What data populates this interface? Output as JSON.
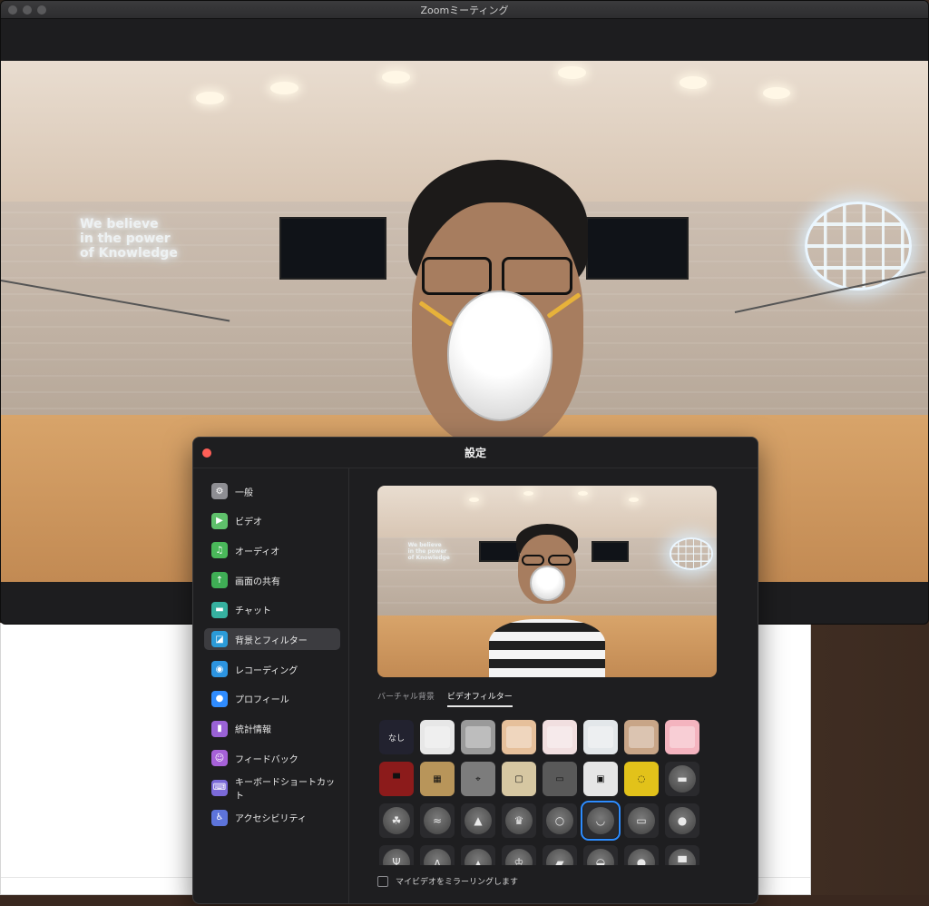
{
  "window": {
    "title": "Zoomミーティング"
  },
  "video": {
    "neon_text": [
      "We believe",
      "in the power",
      "of Knowledge"
    ]
  },
  "settings": {
    "title": "設定",
    "sidebar": [
      {
        "label": "一般",
        "icon": "gear-icon",
        "glyph": "⚙",
        "color": "#8e8e93"
      },
      {
        "label": "ビデオ",
        "icon": "video-camera-icon",
        "glyph": "▶",
        "color": "#5fc16b"
      },
      {
        "label": "オーディオ",
        "icon": "headphones-icon",
        "glyph": "♫",
        "color": "#4ab85a"
      },
      {
        "label": "画面の共有",
        "icon": "share-screen-icon",
        "glyph": "↑",
        "color": "#3fae55"
      },
      {
        "label": "チャット",
        "icon": "chat-bubble-icon",
        "glyph": "▬",
        "color": "#36b1a0"
      },
      {
        "label": "背景とフィルター",
        "icon": "background-filter-icon",
        "glyph": "◪",
        "color": "#2b9bd8",
        "active": true
      },
      {
        "label": "レコーディング",
        "icon": "record-icon",
        "glyph": "◉",
        "color": "#2c94e0"
      },
      {
        "label": "プロフィール",
        "icon": "profile-icon",
        "glyph": "●",
        "color": "#2f8cff"
      },
      {
        "label": "統計情報",
        "icon": "statistics-icon",
        "glyph": "▮",
        "color": "#9a62d6"
      },
      {
        "label": "フィードバック",
        "icon": "feedback-icon",
        "glyph": "☺",
        "color": "#a661d8"
      },
      {
        "label": "キーボードショートカット",
        "icon": "keyboard-icon",
        "glyph": "⌨",
        "color": "#7b6ad8"
      },
      {
        "label": "アクセシビリティ",
        "icon": "accessibility-icon",
        "glyph": "♿",
        "color": "#5d74da"
      }
    ],
    "tabs": [
      {
        "label": "バーチャル背景",
        "active": false
      },
      {
        "label": "ビデオフィルター",
        "active": true
      }
    ],
    "filters": [
      {
        "name": "none",
        "label": "なし",
        "kind": "text",
        "bg": "#22222f"
      },
      {
        "name": "filter-white",
        "kind": "color",
        "bg": "#e7e7e7"
      },
      {
        "name": "filter-gray",
        "kind": "color",
        "bg": "#9a9a9a"
      },
      {
        "name": "filter-peach",
        "kind": "color",
        "bg": "#e6c09b"
      },
      {
        "name": "filter-pink-light",
        "kind": "color",
        "bg": "#f1dfe0"
      },
      {
        "name": "filter-cool-white",
        "kind": "color",
        "bg": "#e3e7ea"
      },
      {
        "name": "filter-tan",
        "kind": "color",
        "bg": "#c8a587"
      },
      {
        "name": "filter-pink",
        "kind": "color",
        "bg": "#f4b4bf"
      },
      {
        "name": "frame-theater-curtain",
        "kind": "frame",
        "bg": "#8c1b1b",
        "glyph": "▀"
      },
      {
        "name": "frame-retro-tv",
        "kind": "frame",
        "bg": "#b8955a",
        "glyph": "▦"
      },
      {
        "name": "frame-focus",
        "kind": "frame",
        "bg": "#7c7c7c",
        "glyph": "⌖"
      },
      {
        "name": "frame-picture",
        "kind": "frame",
        "bg": "#d6c7a2",
        "glyph": "▢"
      },
      {
        "name": "frame-film",
        "kind": "frame",
        "bg": "#595959",
        "glyph": "▭"
      },
      {
        "name": "frame-whiteboard",
        "kind": "frame",
        "bg": "#e6e6e6",
        "glyph": "▣"
      },
      {
        "name": "frame-lights",
        "kind": "frame",
        "bg": "#e2c21a",
        "glyph": "◌"
      },
      {
        "name": "sunglasses",
        "kind": "face",
        "bg": "#2a2a2d",
        "glyph": "▬"
      },
      {
        "name": "sprout",
        "kind": "face",
        "bg": "#2a2a2d",
        "glyph": "☘"
      },
      {
        "name": "rainbow",
        "kind": "face",
        "bg": "#2a2a2d",
        "glyph": "≈"
      },
      {
        "name": "party-hat",
        "kind": "face",
        "bg": "#2a2a2d",
        "glyph": "▲"
      },
      {
        "name": "chef-hat",
        "kind": "face",
        "bg": "#2a2a2d",
        "glyph": "♛"
      },
      {
        "name": "halo",
        "kind": "face",
        "bg": "#2a2a2d",
        "glyph": "○"
      },
      {
        "name": "face-mask",
        "kind": "face",
        "bg": "#2a2a2d",
        "glyph": "◡",
        "selected": true
      },
      {
        "name": "medical-mask",
        "kind": "face",
        "bg": "#2a2a2d",
        "glyph": "▭"
      },
      {
        "name": "mouse-ears",
        "kind": "face",
        "bg": "#2a2a2d",
        "glyph": "●"
      },
      {
        "name": "reindeer",
        "kind": "face",
        "bg": "#2a2a2d",
        "glyph": "Ψ"
      },
      {
        "name": "bunny-ears",
        "kind": "face",
        "bg": "#2a2a2d",
        "glyph": "ʌ"
      },
      {
        "name": "unicorn",
        "kind": "face",
        "bg": "#2a2a2d",
        "glyph": "▴"
      },
      {
        "name": "crown",
        "kind": "face",
        "bg": "#2a2a2d",
        "glyph": "♔"
      },
      {
        "name": "graduation-cap",
        "kind": "face",
        "bg": "#2a2a2d",
        "glyph": "▰"
      },
      {
        "name": "beret",
        "kind": "face",
        "bg": "#2a2a2d",
        "glyph": "◒"
      },
      {
        "name": "dark-face",
        "kind": "face",
        "bg": "#2a2a2d",
        "glyph": "●"
      },
      {
        "name": "detective-hat",
        "kind": "face",
        "bg": "#2a2a2d",
        "glyph": "▀"
      }
    ],
    "mirror": {
      "label": "マイビデオをミラーリングします",
      "checked": false
    }
  }
}
